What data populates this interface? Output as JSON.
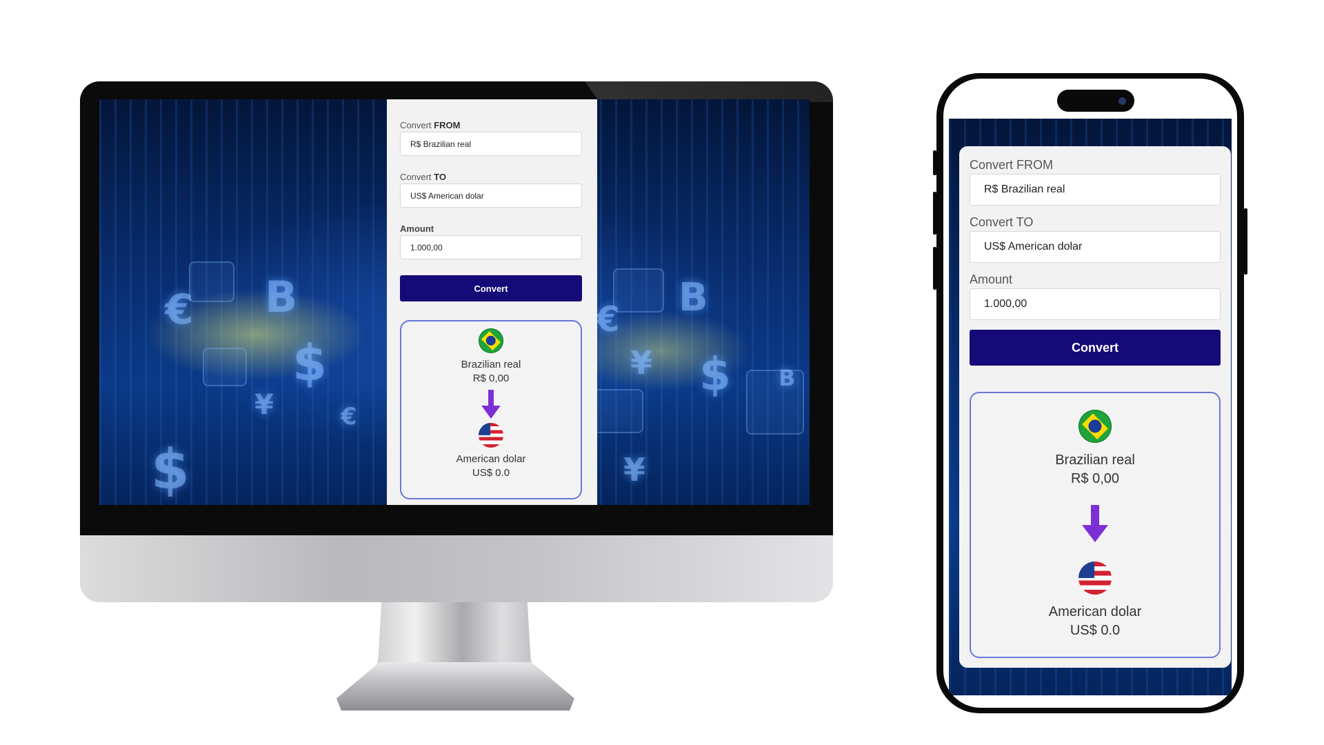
{
  "converter": {
    "from_label_prefix": "Convert ",
    "from_label_strong": "FROM",
    "from_value": "R$ Brazilian real",
    "to_label_prefix": "Convert ",
    "to_label_strong": "TO",
    "to_value": "US$ American dolar",
    "amount_label": "Amount",
    "amount_value": "1.000,00",
    "convert_label": "Convert",
    "result": {
      "from_name": "Brazilian real",
      "from_value": "R$ 0,00",
      "to_name": "American dolar",
      "to_value": "US$ 0.0"
    }
  },
  "mobile_converter": {
    "from_label": "Convert FROM",
    "from_value": "R$ Brazilian real",
    "to_label": "Convert TO",
    "to_value": "US$ American dolar",
    "amount_label": "Amount",
    "amount_value": "1.000,00",
    "convert_label": "Convert",
    "result": {
      "from_name": "Brazilian real",
      "from_value": "R$ 0,00",
      "to_name": "American dolar",
      "to_value": "US$ 0.0"
    }
  },
  "background_symbols": [
    "€",
    "B",
    "$",
    "¥",
    "€",
    "B",
    "$",
    "¥",
    "B",
    "$",
    "€",
    "¥"
  ],
  "icons": {
    "from_flag": "brazil-flag-icon",
    "to_flag": "usa-flag-icon",
    "arrow": "arrow-down-icon"
  },
  "colors": {
    "button": "#150a78",
    "result_border": "#6a76d8",
    "arrow": "#7d2fd6",
    "background": "#0b3a88"
  }
}
